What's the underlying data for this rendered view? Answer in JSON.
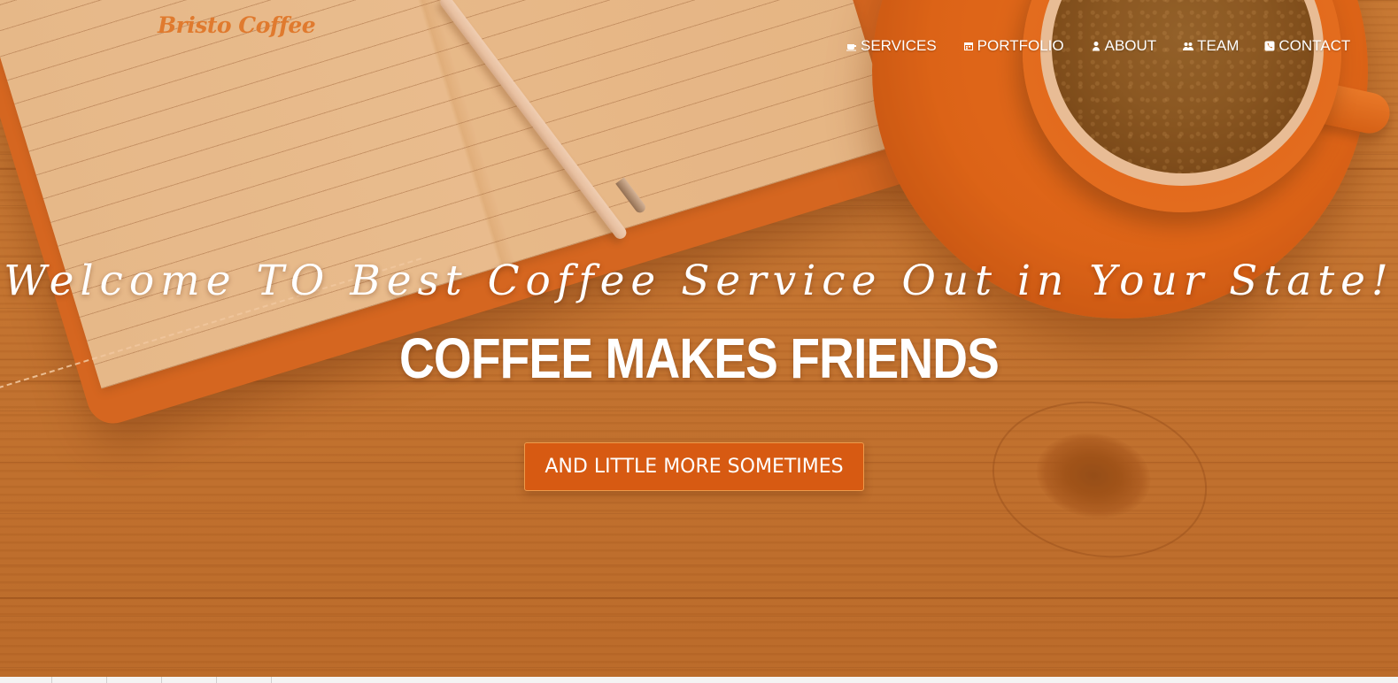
{
  "brand": {
    "name": "Bristo Coffee",
    "color": "#e07a2e"
  },
  "nav": {
    "items": [
      {
        "label": "SERVICES",
        "icon": "coffee-cup-icon"
      },
      {
        "label": "PORTFOLIO",
        "icon": "calendar-icon"
      },
      {
        "label": "ABOUT",
        "icon": "user-icon"
      },
      {
        "label": "TEAM",
        "icon": "users-icon"
      },
      {
        "label": "CONTACT",
        "icon": "phone-icon"
      }
    ]
  },
  "hero": {
    "tagline": "Welcome TO Best Coffee Service Out in Your State!",
    "headline": "COFFEE MAKES FRIENDS",
    "cta_label": "AND LITTLE MORE SOMETIMES",
    "cta_color": "#d75a12",
    "overlay_color": "#cd7026"
  }
}
